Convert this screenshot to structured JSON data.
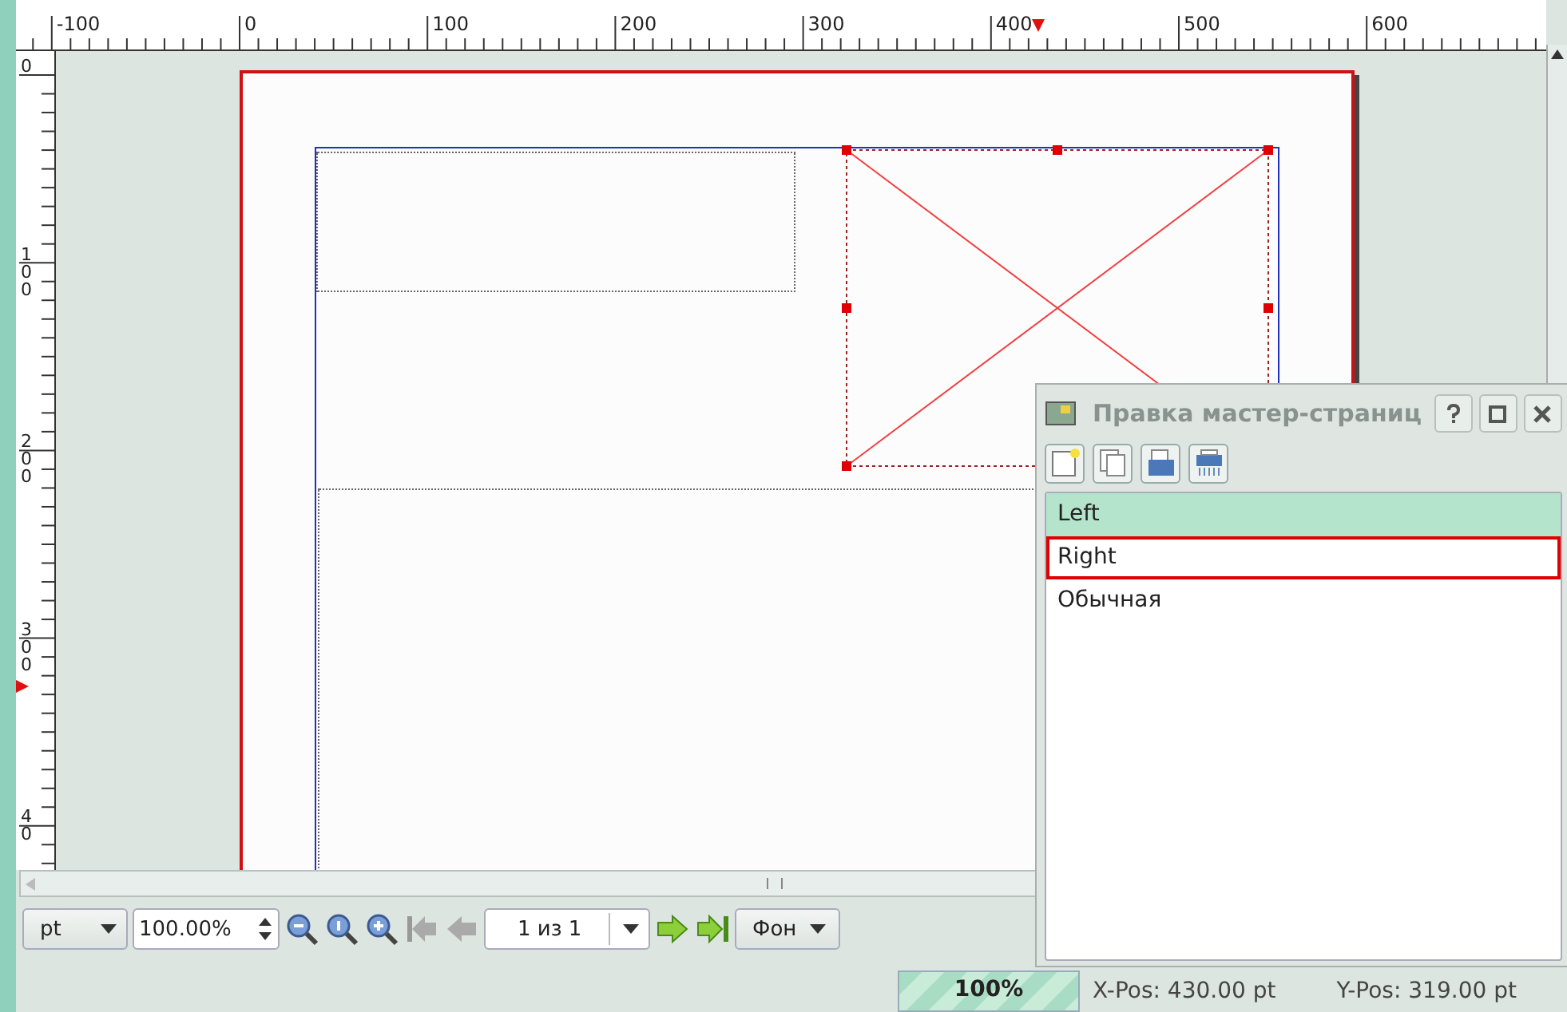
{
  "rulers": {
    "horizontal": [
      "-100",
      "0",
      "100",
      "200",
      "300",
      "400",
      "500",
      "600"
    ],
    "vertical": [
      "0",
      "100",
      "200",
      "300",
      "40"
    ]
  },
  "toolbar": {
    "unit": "pt",
    "zoom": "100.00%",
    "page": "1 из 1",
    "layer": "Фон"
  },
  "status_bar": {
    "progress": "100%",
    "level": 1,
    "x_pos": "X-Pos: 430.00 pt",
    "y_pos": "Y-Pos: 319.00 pt"
  },
  "dialog": {
    "title": "Правка мастер-страниц",
    "items": [
      {
        "label": "Left",
        "selected": true,
        "current": false
      },
      {
        "label": "Right",
        "selected": false,
        "current": true
      },
      {
        "label": "Обычная",
        "selected": false,
        "current": false
      }
    ]
  }
}
